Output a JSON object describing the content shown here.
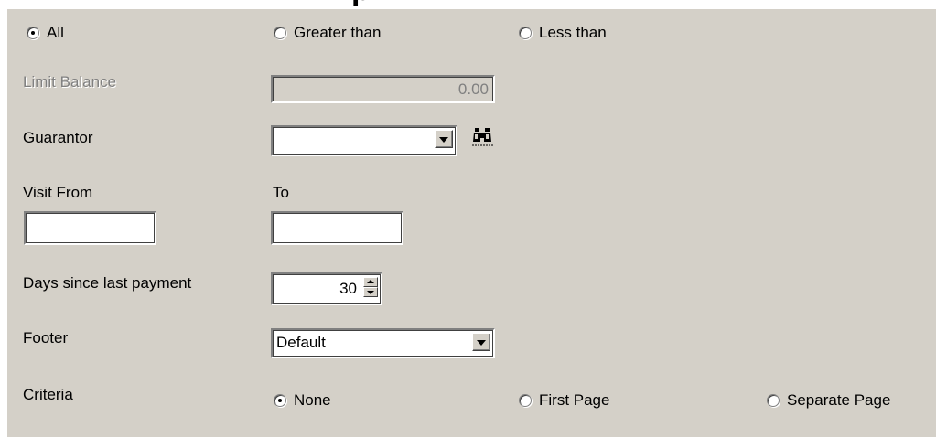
{
  "title_fragment": "p",
  "balance_filter": {
    "options": [
      {
        "label": "All",
        "checked": true
      },
      {
        "label": "Greater than",
        "checked": false
      },
      {
        "label": "Less than",
        "checked": false
      }
    ]
  },
  "limit_balance": {
    "label": "Limit Balance",
    "value": "0.00",
    "enabled": false
  },
  "guarantor": {
    "label": "Guarantor",
    "value": "",
    "search_icon": "binoculars-icon"
  },
  "visit": {
    "from_label": "Visit From",
    "to_label": "To",
    "from_value": "",
    "to_value": ""
  },
  "days_since_payment": {
    "label": "Days since last payment",
    "value": "30"
  },
  "footer": {
    "label": "Footer",
    "value": "Default"
  },
  "criteria": {
    "label": "Criteria",
    "options": [
      {
        "label": "None",
        "checked": true
      },
      {
        "label": "First Page",
        "checked": false
      },
      {
        "label": "Separate Page",
        "checked": false
      }
    ]
  },
  "colors": {
    "panel": "#d4d0c8",
    "disabled_text": "#808080"
  }
}
